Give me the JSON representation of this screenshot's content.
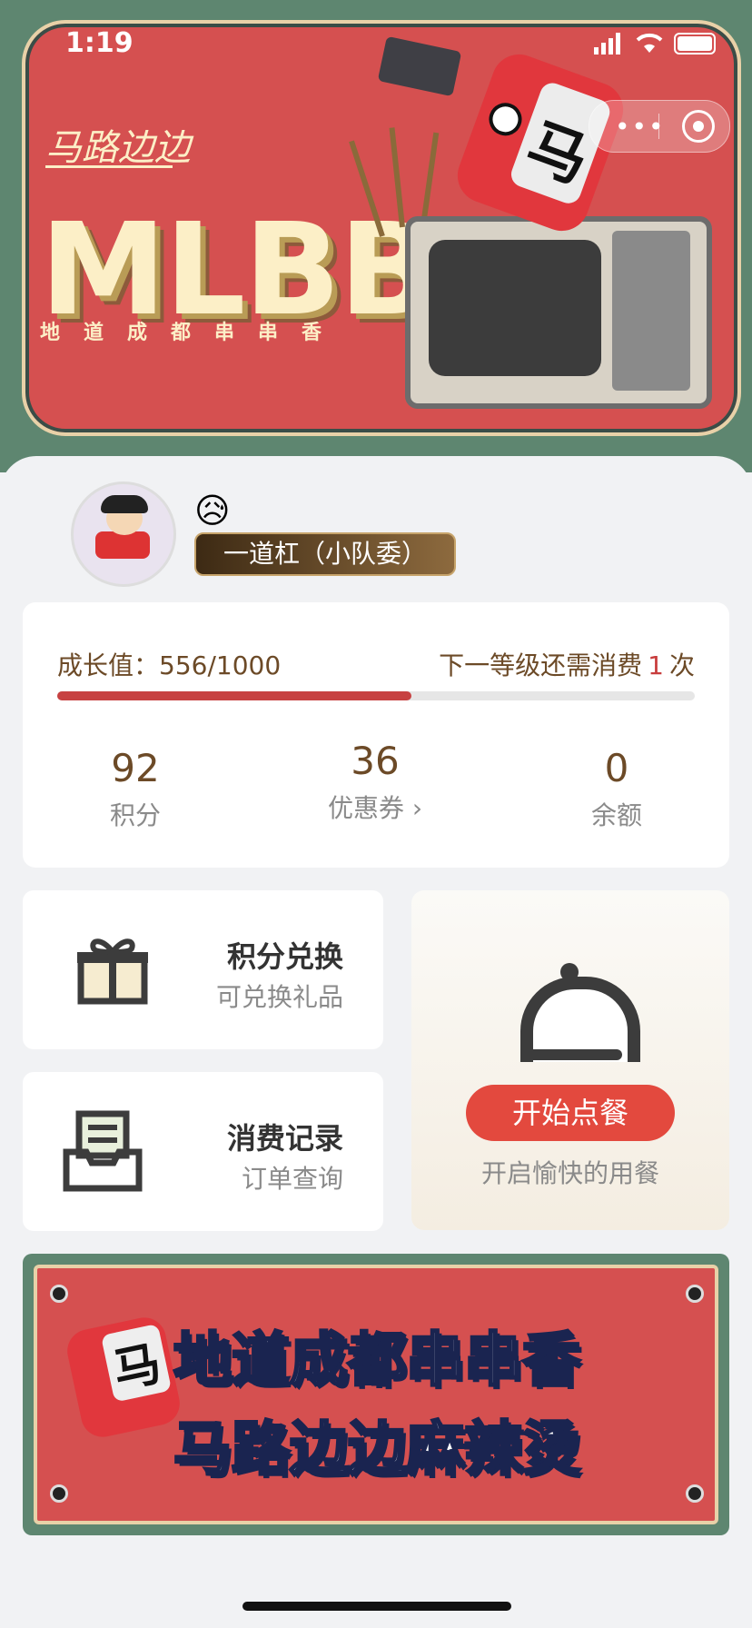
{
  "status_bar": {
    "time": "1:19"
  },
  "hero": {
    "brand": "马路边边",
    "headline": "MLBB",
    "subtitle": "地道成都串串香",
    "mascot_char": "马"
  },
  "profile": {
    "emoji": "😥",
    "level": "一道杠（小队委）"
  },
  "growth": {
    "label": "成长值：556/1000",
    "next_prefix": "下一等级还需消费",
    "next_count": "1",
    "next_suffix": "次",
    "progress_fraction": 0.556
  },
  "stats": [
    {
      "value": "92",
      "label": "积分"
    },
    {
      "value": "36",
      "label": "优惠券 ›"
    },
    {
      "value": "0",
      "label": "余额"
    }
  ],
  "tiles": {
    "points": {
      "title": "积分兑换",
      "desc": "可兑换礼品"
    },
    "records": {
      "title": "消费记录",
      "desc": "订单查询"
    },
    "order": {
      "button": "开始点餐",
      "desc": "开启愉快的用餐"
    }
  },
  "promo": {
    "line1": "地道成都串串香",
    "line2": "马路边边麻辣烫",
    "mascot_char": "马"
  },
  "colors": {
    "accent_red": "#d55050",
    "dark_green": "#5e8670",
    "brown_text": "#6c4a27"
  }
}
